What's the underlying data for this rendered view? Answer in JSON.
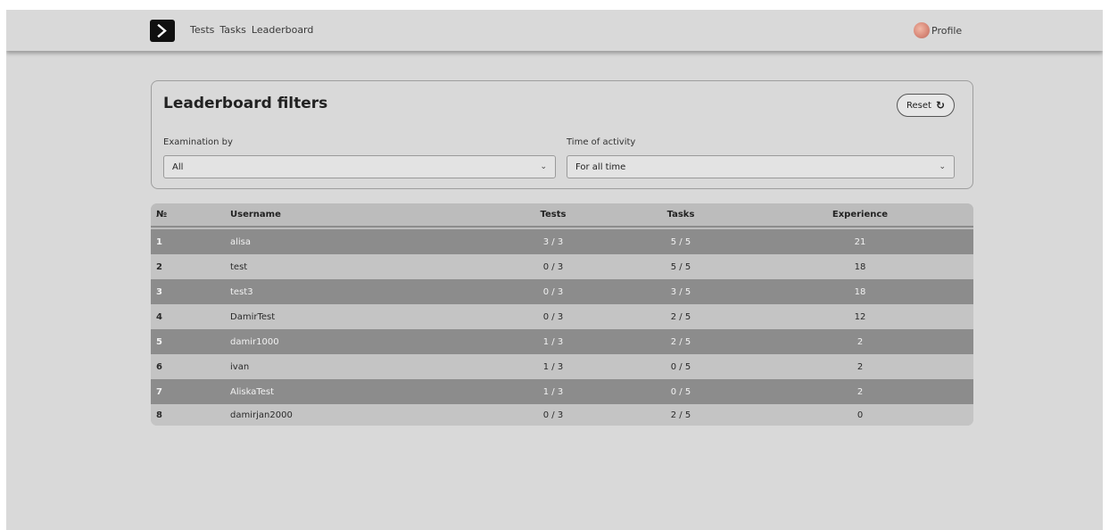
{
  "nav": {
    "links": [
      "Tests",
      "Tasks",
      "Leaderboard"
    ],
    "profile_label": "Profile"
  },
  "filters": {
    "title": "Leaderboard filters",
    "reset_label": "Reset",
    "exam_label": "Examination by",
    "exam_value": "All",
    "time_label": "Time of activity",
    "time_value": "For all time"
  },
  "table": {
    "headers": {
      "num": "№",
      "username": "Username",
      "tests": "Tests",
      "tasks": "Tasks",
      "experience": "Experience"
    },
    "rows": [
      {
        "num": "1",
        "username": "alisa",
        "tests": "3 / 3",
        "tasks": "5 / 5",
        "experience": "21"
      },
      {
        "num": "2",
        "username": "test",
        "tests": "0 / 3",
        "tasks": "5 / 5",
        "experience": "18"
      },
      {
        "num": "3",
        "username": "test3",
        "tests": "0 / 3",
        "tasks": "3 / 5",
        "experience": "18"
      },
      {
        "num": "4",
        "username": "DamirTest",
        "tests": "0 / 3",
        "tasks": "2 / 5",
        "experience": "12"
      },
      {
        "num": "5",
        "username": "damir1000",
        "tests": "1 / 3",
        "tasks": "2 / 5",
        "experience": "2"
      },
      {
        "num": "6",
        "username": "ivan",
        "tests": "1 / 3",
        "tasks": "0 / 5",
        "experience": "2"
      },
      {
        "num": "7",
        "username": "AliskaTest",
        "tests": "1 / 3",
        "tasks": "0 / 5",
        "experience": "2"
      },
      {
        "num": "8",
        "username": "damirjan2000",
        "tests": "0 / 3",
        "tasks": "2 / 5",
        "experience": "0"
      }
    ]
  },
  "colors": {
    "background": "#d9d9d9",
    "row_dark": "#8c8c8c",
    "row_light": "#c4c4c4",
    "logo": "#101010"
  }
}
